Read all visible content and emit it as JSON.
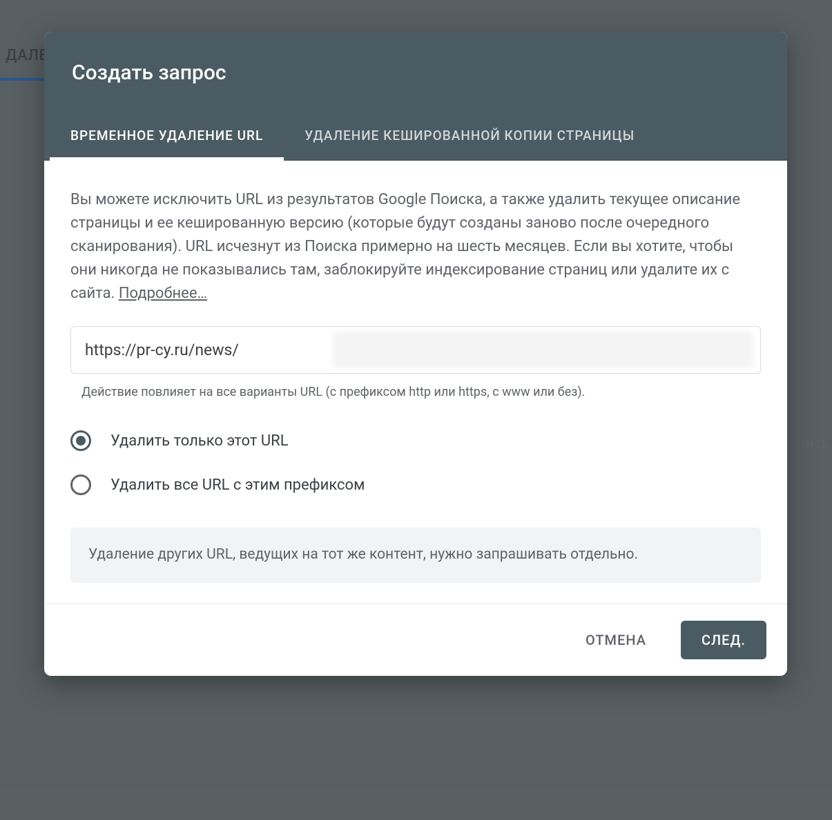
{
  "background": {
    "tab_partial": "ДАЛЕ",
    "hint_partial": "ись."
  },
  "dialog": {
    "title": "Создать запрос",
    "tabs": {
      "temporary": "ВРЕМЕННОЕ УДАЛЕНИЕ URL",
      "cached": "УДАЛЕНИЕ КЕШИРОВАННОЙ КОПИИ СТРАНИЦЫ"
    },
    "description": "Вы можете исключить URL из результатов Google Поиска, а также удалить текущее описание страницы и ее кешированную версию (которые будут созданы заново после очередного сканирования). URL исчезнут из Поиска примерно на шесть месяцев. Если вы хотите, чтобы они никогда не показывались там, заблокируйте индексирование страниц или удалите их с сайта. ",
    "learn_more": "Подробнее…",
    "url_value": "https://pr-cy.ru/news/",
    "url_hint": "Действие повлияет на все варианты URL (с префиксом http или https, с www или без).",
    "radios": {
      "only_this": "Удалить только этот URL",
      "prefix": "Удалить все URL с этим префиксом",
      "selected": "only_this"
    },
    "note": "Удаление других URL, ведущих на тот же контент, нужно запрашивать отдельно.",
    "buttons": {
      "cancel": "ОТМЕНА",
      "next": "СЛЕД."
    }
  }
}
